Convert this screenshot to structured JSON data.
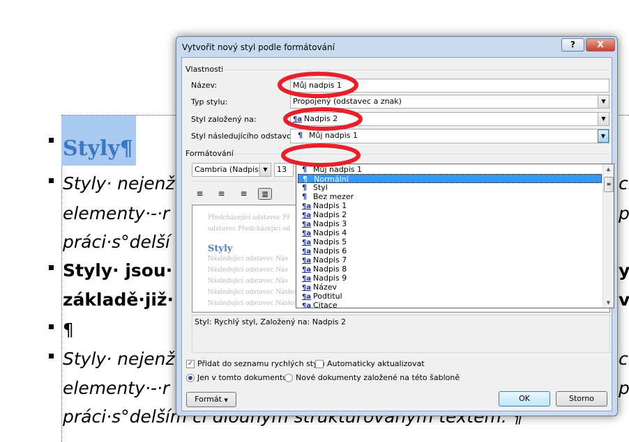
{
  "document": {
    "heading": "Styly¶",
    "lines_left": [
      "Styly· nejenž",
      "elementy·-·r",
      "práci·s°delší",
      "Styly· jsou·",
      "základě·již·",
      "¶",
      "Styly· nejenž",
      "elementy·-·r",
      "práci·s°delším či dlouhým strukturovaným textem. ¶"
    ],
    "lines_right": [
      "ch",
      "p",
      "y",
      "vo",
      "ch",
      "p"
    ]
  },
  "dialog": {
    "title": "Vytvořit nový styl podle formátování",
    "help_label": "?",
    "close_label": "X",
    "properties_group": "Vlastnosti",
    "name_label": "Název:",
    "name_value": "Můj nadpis 1",
    "type_label": "Typ stylu:",
    "type_value": "Propojený (odstavec a znak)",
    "based_on_label": "Styl založený na:",
    "based_on_value": "Nadpis 2",
    "next_label": "Styl následujícího odstavce:",
    "next_value": "Můj nadpis 1",
    "dropdown_items": [
      "Můj nadpis 1",
      "Normální",
      "Styl",
      "Bez mezer",
      "Nadpis 1",
      "Nadpis 2",
      "Nadpis 3",
      "Nadpis 4",
      "Nadpis 5",
      "Nadpis 6",
      "Nadpis 7",
      "Nadpis 8",
      "Nadpis 9",
      "Název",
      "Podtitul",
      "Citace"
    ],
    "selected_item": "Normální",
    "formatting_group": "Formátování",
    "font_value": "Cambria (Nadpisy)",
    "size_value": "13",
    "preview": {
      "prev_1": "Předcházející odstavec Př",
      "prev_2": "odstavec Předcházející od",
      "sample": "Styly",
      "next_short": "Následující odstavec Nás",
      "next_long": "Následující odstavec Následující odstavec Následující odstavec Následující odstavec Následující odstavec"
    },
    "description": "Styl: Rychlý styl, Založený na: Nadpis 2",
    "add_quick_label": "Přidat do seznamu rychlých stylů",
    "add_quick_checked": true,
    "auto_update_label": "Automaticky aktualizovat",
    "auto_update_checked": false,
    "only_doc_label": "Jen v tomto dokumentu",
    "new_docs_label": "Nové dokumenty založené na této šabloně",
    "format_button": "Formát",
    "ok_button": "OK",
    "cancel_button": "Storno"
  },
  "annotation_color": "#e8202a"
}
